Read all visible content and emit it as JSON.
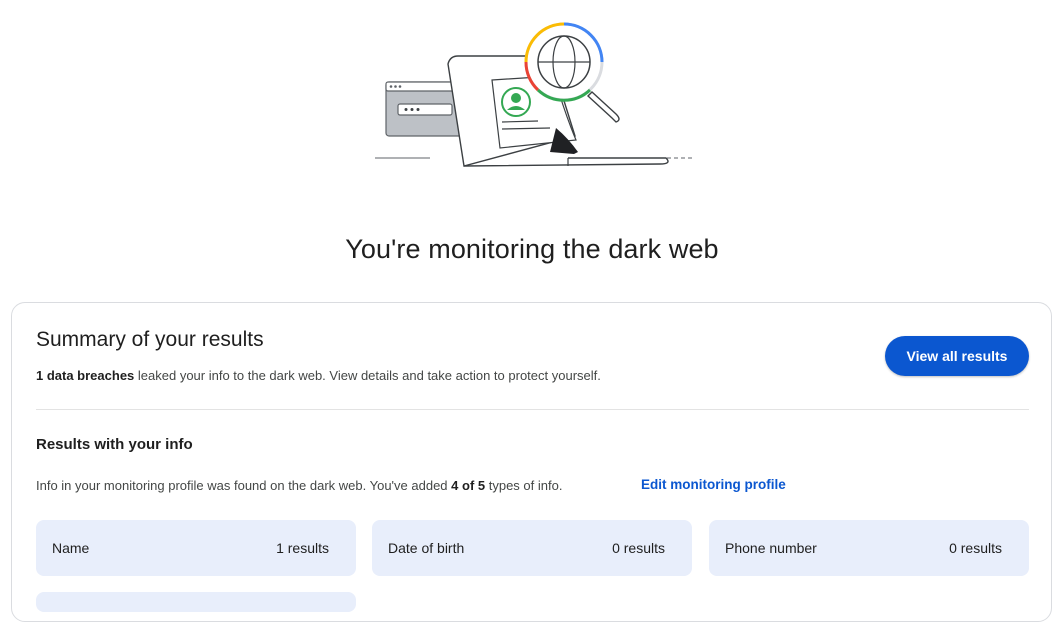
{
  "page": {
    "title": "You're monitoring the dark web"
  },
  "hero": {
    "illustration_icon": "laptop-dark-web-search-illustration",
    "accent_colors": [
      "#4285f4",
      "#ea4335",
      "#fbbc04",
      "#34a853"
    ]
  },
  "summary": {
    "title": "Summary of your results",
    "breach_count_text": "1 data breaches",
    "description_rest": " leaked your info to the dark web. View details and take action to protect yourself.",
    "view_all_label": "View all results",
    "button_color": "#0b57d0"
  },
  "results": {
    "title": "Results with your info",
    "desc_before": "Info in your monitoring profile was found on the dark web. You've added ",
    "desc_count": "4 of 5",
    "desc_after": " types of info.",
    "edit_link_label": "Edit monitoring profile",
    "tile_color": "#e8eefb",
    "tiles": [
      {
        "label": "Name",
        "count": "1 results"
      },
      {
        "label": "Date of birth",
        "count": "0 results"
      },
      {
        "label": "Phone number",
        "count": "0 results"
      }
    ]
  }
}
